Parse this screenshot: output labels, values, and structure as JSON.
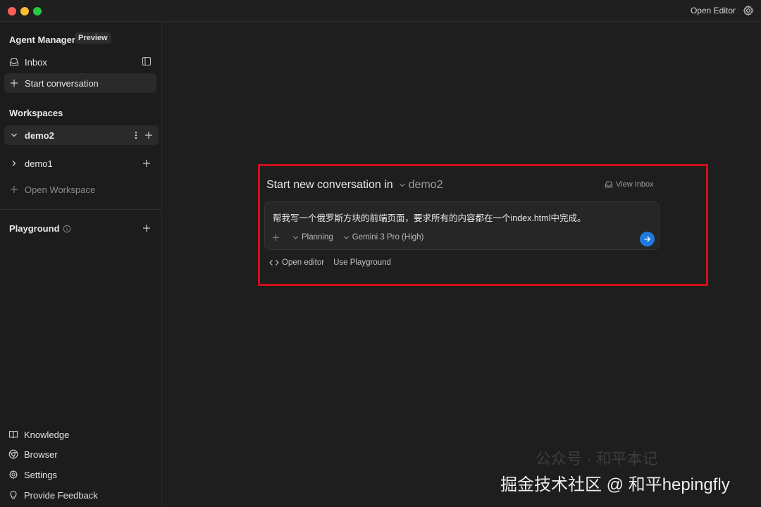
{
  "titlebar": {
    "open_editor_label": "Open Editor"
  },
  "sidebar": {
    "app_title": "Agent Manager",
    "badge": "Preview",
    "inbox_label": "Inbox",
    "start_conversation_label": "Start conversation",
    "workspaces_heading": "Workspaces",
    "workspaces": [
      {
        "name": "demo2",
        "expanded": true,
        "active": true
      },
      {
        "name": "demo1",
        "expanded": false,
        "active": false
      }
    ],
    "open_workspace_label": "Open Workspace",
    "playground_label": "Playground",
    "bottom_items": [
      {
        "label": "Knowledge",
        "icon": "book-icon"
      },
      {
        "label": "Browser",
        "icon": "chrome-icon"
      },
      {
        "label": "Settings",
        "icon": "gear-icon"
      },
      {
        "label": "Provide Feedback",
        "icon": "lightbulb-icon"
      }
    ]
  },
  "main": {
    "title": "Start new conversation in",
    "workspace": "demo2",
    "view_inbox_label": "View Inbox",
    "prompt_text": "帮我写一个俄罗斯方块的前端页面，要求所有的内容都在一个index.html中完成。",
    "mode_label": "Planning",
    "model_label": "Gemini 3 Pro (High)",
    "open_editor_label": "Open editor",
    "use_playground_label": "Use Playground"
  },
  "watermark": {
    "primary": "掘金技术社区 @ 和平hepingfly",
    "secondary": "公众号 · 和平本记"
  },
  "colors": {
    "accent": "#1f7ae0",
    "highlight_border": "#d0101a",
    "background": "#1e1e1e"
  }
}
